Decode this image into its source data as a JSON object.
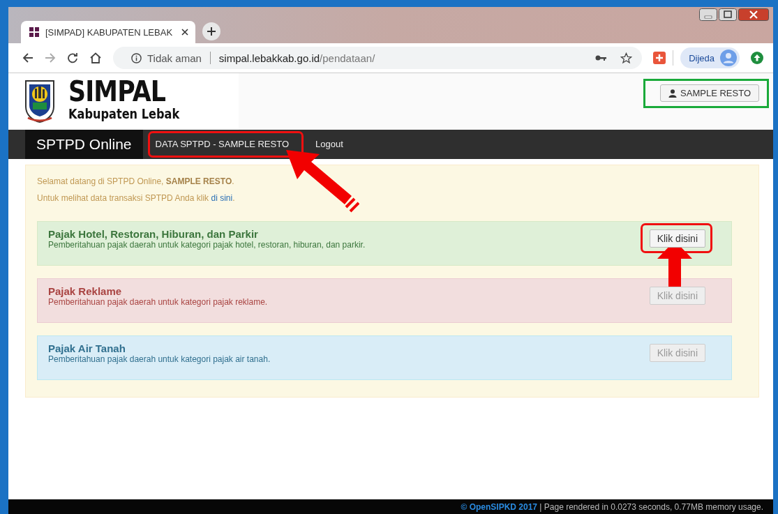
{
  "browser": {
    "tab_title": "[SIMPAD] KABUPATEN LEBAK",
    "security": "Tidak aman",
    "host": "simpal.lebakkab.go.id",
    "path": "/pendataan/",
    "profile": "Dijeda"
  },
  "header": {
    "logo_title": "SIMPAL",
    "logo_subtitle": "Kabupaten Lebak",
    "user_button": "SAMPLE RESTO"
  },
  "navbar": {
    "brand": "SPTPD Online",
    "items": [
      {
        "label": "DATA SPTPD - SAMPLE RESTO"
      },
      {
        "label": "Logout"
      }
    ]
  },
  "welcome": {
    "greeting": "Selamat datang di SPTPD Online, **SAMPLE RESTO**.",
    "hint_before": "Untuk melihat data transaksi SPTPD Anda klik ",
    "hint_link": "di sini",
    "hint_after": "."
  },
  "panels": [
    {
      "kind": "success",
      "title": "Pajak Hotel, Restoran, Hiburan, dan Parkir",
      "description": "Pemberitahuan pajak daerah untuk kategori pajak hotel, restoran, hiburan, dan parkir.",
      "button": "Klik disini",
      "disabled": false
    },
    {
      "kind": "danger",
      "title": "Pajak Reklame",
      "description": "Pemberitahuan pajak daerah untuk kategori pajak reklame.",
      "button": "Klik disini",
      "disabled": true
    },
    {
      "kind": "info",
      "title": "Pajak Air Tanah",
      "description": "Pemberitahuan pajak daerah untuk kategori pajak air tanah.",
      "button": "Klik disini",
      "disabled": true
    }
  ],
  "footer": "**© OpenSIPKD 2017** | Page rendered in 0.0273 seconds, 0.77MB memory usage."
}
